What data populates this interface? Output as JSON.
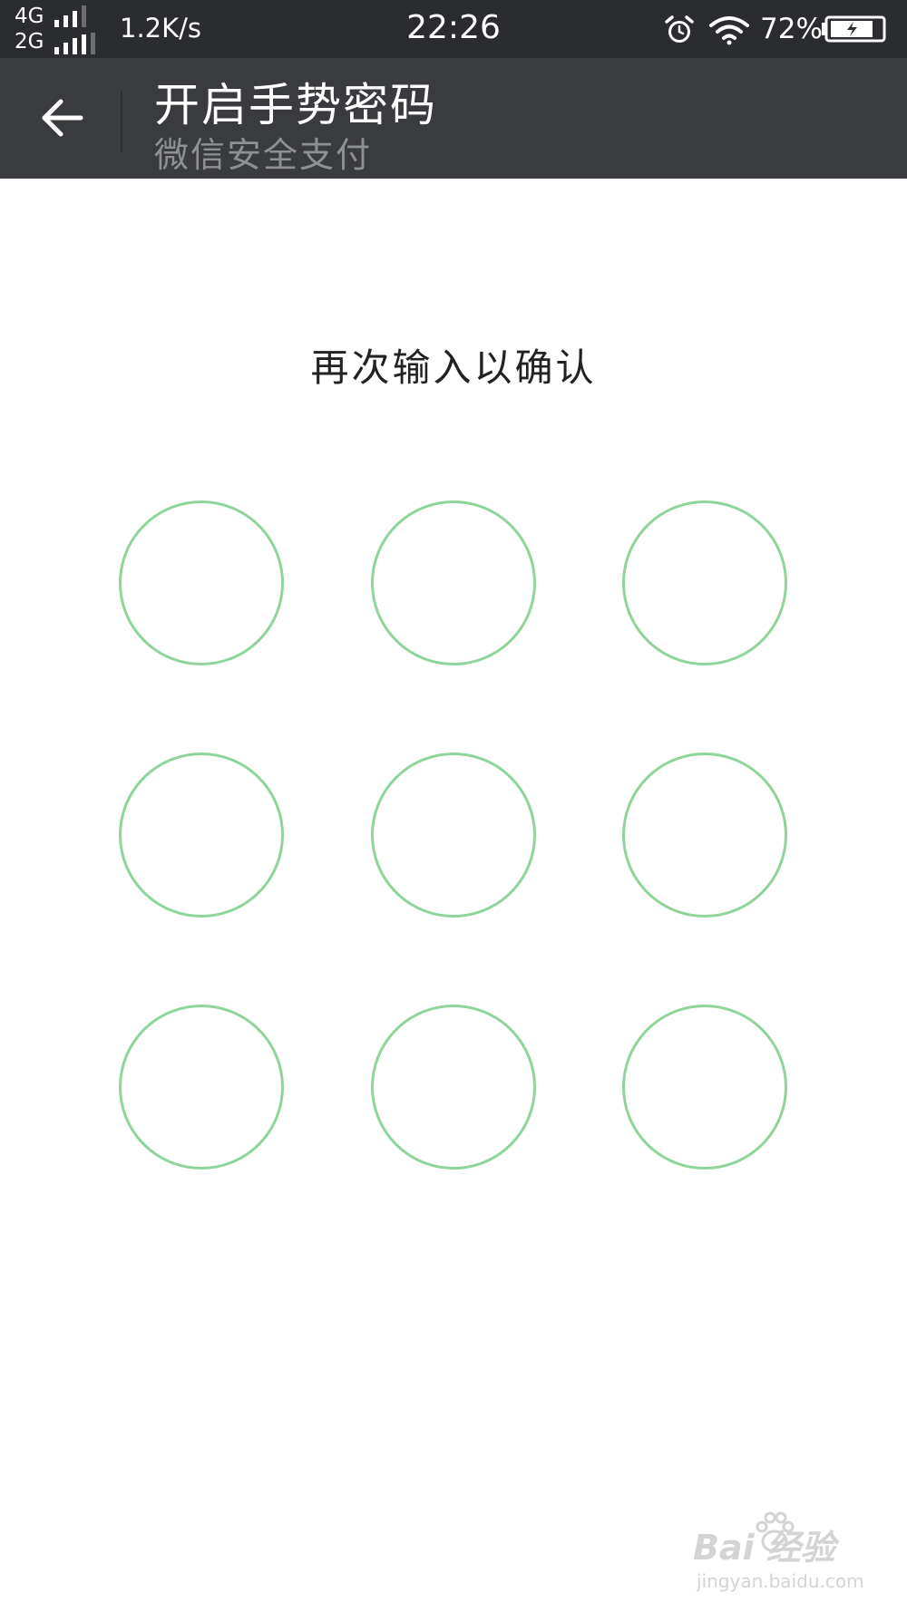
{
  "status_bar": {
    "network_top": "4G",
    "network_bottom": "2G",
    "net_speed": "1.2K/s",
    "time": "22:26",
    "battery_percent": "72%",
    "icons": [
      "signal-icon",
      "alarm-icon",
      "wifi-icon",
      "battery-charging-icon"
    ]
  },
  "header": {
    "back_icon": "arrow-left-icon",
    "title": "开启手势密码",
    "subtitle": "微信安全支付"
  },
  "main": {
    "prompt": "再次输入以确认",
    "pattern_dots": 9,
    "dot_color": "#8fd49a"
  },
  "watermark": {
    "logo": "Bai  经验",
    "url": "jingyan.baidu.com"
  },
  "colors": {
    "status_bar_bg": "#2b2c30",
    "header_bg": "#3a3b3f",
    "title_color": "#ffffff",
    "subtitle_color": "#8f9094",
    "background": "#ffffff"
  }
}
